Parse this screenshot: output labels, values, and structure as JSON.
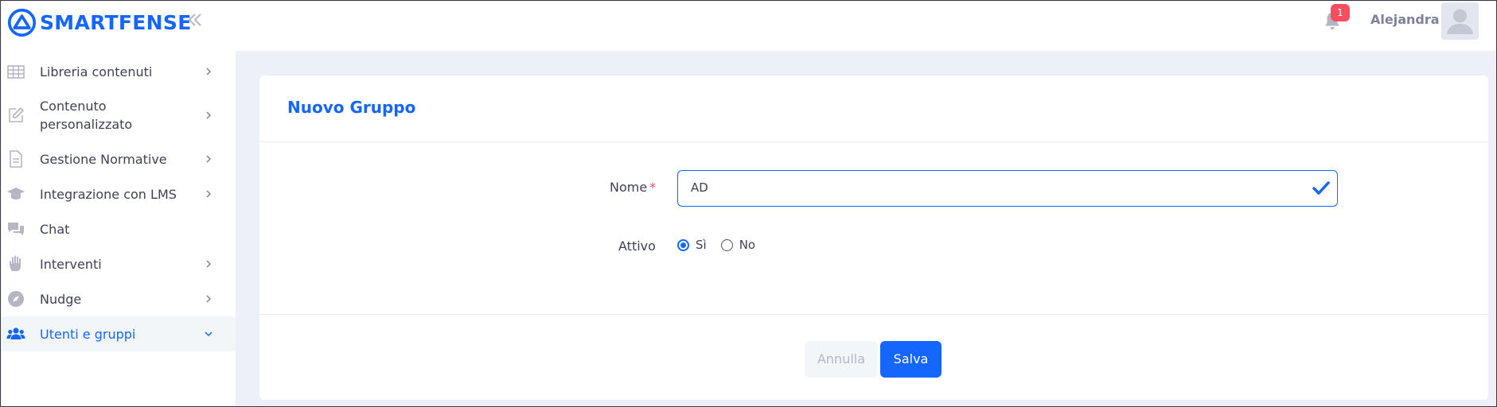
{
  "brand": {
    "name": "SMARTFENSE"
  },
  "sidebar": {
    "items": [
      {
        "label": "Libreria contenuti",
        "icon": "grid-icon",
        "has_chevron": true
      },
      {
        "label": "Contenuto personalizzato",
        "icon": "edit-icon",
        "has_chevron": true
      },
      {
        "label": "Gestione Normative",
        "icon": "document-icon",
        "has_chevron": true
      },
      {
        "label": "Integrazione con LMS",
        "icon": "graduation-cap-icon",
        "has_chevron": true
      },
      {
        "label": "Chat",
        "icon": "chat-icon",
        "has_chevron": false
      },
      {
        "label": "Interventi",
        "icon": "hand-icon",
        "has_chevron": true
      },
      {
        "label": "Nudge",
        "icon": "compass-icon",
        "has_chevron": true
      },
      {
        "label": "Utenti e gruppi",
        "icon": "users-icon",
        "has_chevron": true,
        "active": true
      }
    ]
  },
  "topbar": {
    "notification_count": "1",
    "username": "Alejandra"
  },
  "form": {
    "title": "Nuovo Gruppo",
    "nome_label": "Nome",
    "required_mark": "*",
    "nome_value": "AD",
    "attivo_label": "Attivo",
    "attivo_options": [
      "Sì",
      "No"
    ],
    "attivo_selected": "Sì",
    "cancel_label": "Annulla",
    "save_label": "Salva"
  },
  "colors": {
    "accent": "#1466ff",
    "badge": "#f64e60",
    "text": "#3f4254",
    "background": "#eef0f8"
  }
}
